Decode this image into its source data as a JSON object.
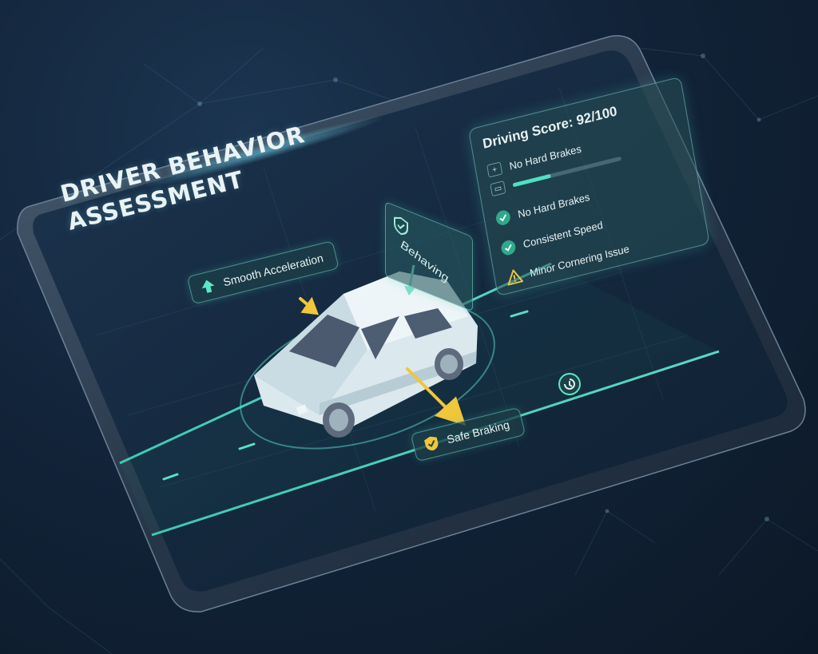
{
  "title": {
    "line1": "DRIVER BEHAVIOR",
    "line2": "ASSESSMENT"
  },
  "tags": {
    "acceleration": "Smooth Acceleration",
    "braking": "Safe Braking",
    "badge": "Behaving"
  },
  "score_panel": {
    "title": "Driving Score: 92/100",
    "metric_label": "No Hard Brakes",
    "metric_progress": 0.35,
    "items": [
      {
        "label": "No Hard Brakes",
        "status": "ok",
        "icon": "check-icon"
      },
      {
        "label": "Consistent Speed",
        "status": "ok",
        "icon": "check-icon"
      },
      {
        "label": "Minor Cornering Issue",
        "status": "warning",
        "icon": "warning-icon"
      }
    ]
  },
  "colors": {
    "accent": "#4ee0c2",
    "ok": "#2fa98b",
    "warning": "#f2c43d",
    "arrow": "#f0c63a",
    "screen": "#15283c",
    "bezel": "#2c3b4c"
  }
}
